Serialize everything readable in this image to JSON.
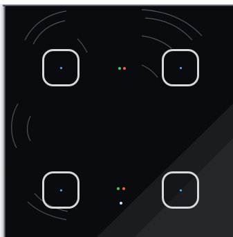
{
  "colors": {
    "glass": "#0a0b0f",
    "frame": "#d6d8dc",
    "arc": "#5d6068",
    "led_blue": "#4fb3ff",
    "led_green": "#3ecf5a",
    "led_red": "#ff5a3c",
    "led_white": "#cfe6ff"
  },
  "icons": {
    "touch_button": "rounded-square-outline",
    "indicator": "led-dot",
    "proximity_arc": "arc-outline"
  }
}
